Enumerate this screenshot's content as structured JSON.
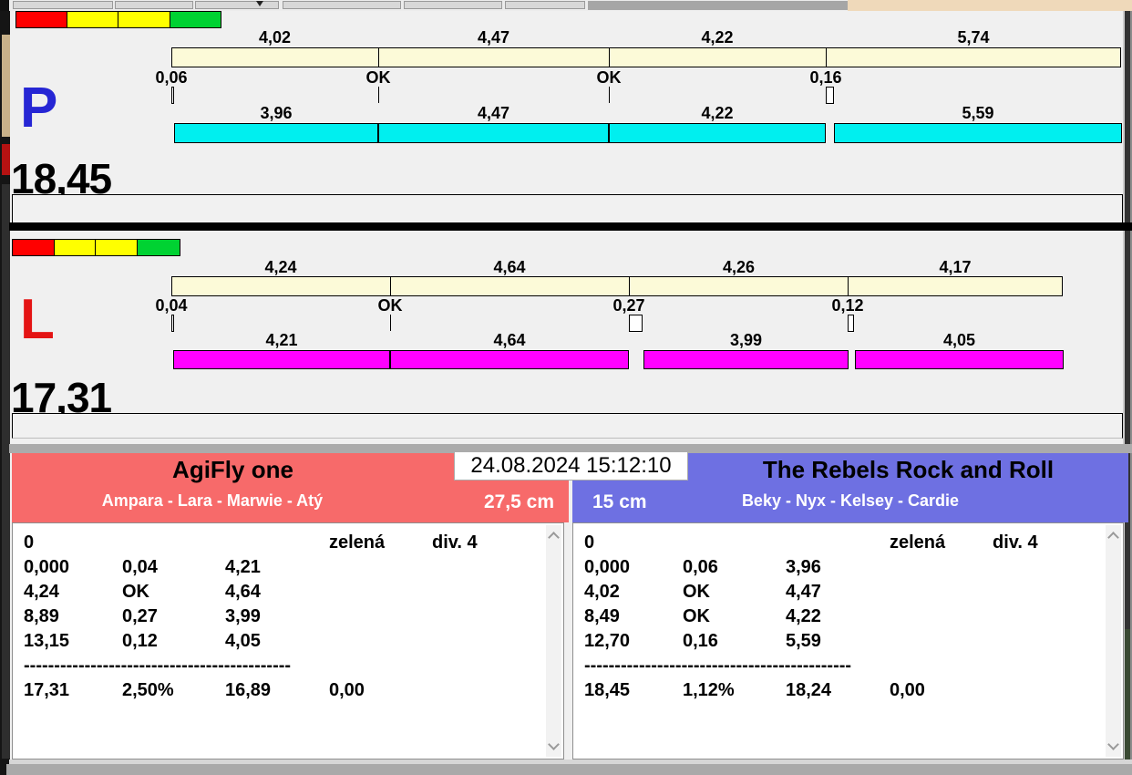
{
  "colors": {
    "panel_bg": "#F0F0F0",
    "split_bar": "#FCFAD8",
    "run_bar_p": "#00EFEF",
    "run_bar_l": "#FF00FF",
    "light_red": "#FF0000",
    "light_yellow": "#FFFF00",
    "light_green": "#00D232",
    "letter_p": "#2626D4",
    "letter_l": "#E41414",
    "team_left_header": "#F76A6A",
    "team_right_header": "#6E70E2",
    "separator": "#000000"
  },
  "panel_p": {
    "letter": "P",
    "letter_color": "#2626D4",
    "total": "18,45",
    "lights": [
      "#FF0000",
      "#FFFF00",
      "#FFFF00",
      "#00D232"
    ],
    "splits": [
      "4,02",
      "4,47",
      "4,22",
      "5,74"
    ],
    "changeovers": [
      "0,06",
      "OK",
      "OK",
      "0,16"
    ],
    "runs": [
      "3,96",
      "4,47",
      "4,22",
      "5,59"
    ],
    "run_color": "#00EFEF"
  },
  "panel_l": {
    "letter": "L",
    "letter_color": "#E41414",
    "total": "17,31",
    "lights": [
      "#FF0000",
      "#FFFF00",
      "#FFFF00",
      "#00D232"
    ],
    "splits": [
      "4,24",
      "4,64",
      "4,26",
      "4,17"
    ],
    "changeovers": [
      "0,04",
      "OK",
      "0,27",
      "0,12"
    ],
    "runs": [
      "4,21",
      "4,64",
      "3,99",
      "4,05"
    ],
    "run_color": "#FF00FF"
  },
  "scoreboard": {
    "datetime": "24.08.2024 15:12:10",
    "left_team": {
      "name": "AgiFly one",
      "members": "Ampara - Lara - Marwie - Atý",
      "height": "27,5 cm",
      "header_color": "#F76A6A",
      "table": {
        "first_row": {
          "start": "0",
          "status": "zelená",
          "division": "div. 4"
        },
        "rows": [
          [
            "0,000",
            "0,04",
            "4,21"
          ],
          [
            "4,24",
            "OK",
            "4,64"
          ],
          [
            "8,89",
            "0,27",
            "3,99"
          ],
          [
            "13,15",
            "0,12",
            "4,05"
          ]
        ],
        "separator": "--------------------------------------------",
        "totals": [
          "17,31",
          "2,50%",
          "16,89",
          "0,00"
        ]
      }
    },
    "right_team": {
      "name": "The Rebels Rock and Roll",
      "members": "Beky - Nyx - Kelsey - Cardie",
      "height": "15 cm",
      "header_color": "#6E70E2",
      "table": {
        "first_row": {
          "start": "0",
          "status": "zelená",
          "division": "div. 4"
        },
        "rows": [
          [
            "0,000",
            "0,06",
            "3,96"
          ],
          [
            "4,02",
            "OK",
            "4,47"
          ],
          [
            "8,49",
            "OK",
            "4,22"
          ],
          [
            "12,70",
            "0,16",
            "5,59"
          ]
        ],
        "separator": "--------------------------------------------",
        "totals": [
          "18,45",
          "1,12%",
          "18,24",
          "0,00"
        ]
      }
    }
  }
}
